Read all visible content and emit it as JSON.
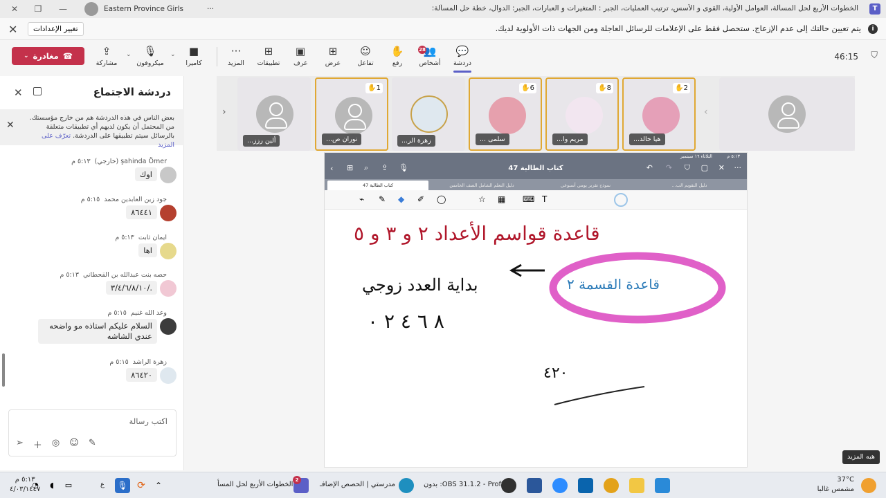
{
  "window": {
    "title": "الخطوات الأربع لحل المسألة، العوامل الأولية، القوى و الأسس، ترتيب العمليات، الجبر : المتغيرات و العبارات، الجبر: الدوال، خطة حل المسألة: التخمين والـ...",
    "account": "Eastern Province Girls",
    "more": "···",
    "app_icon_label": "T"
  },
  "notification": {
    "message": "يتم تعيين حالتك إلى عدم الإزعاج. ستحصل فقط على الإعلامات للرسائل العاجلة ومن الجهات ذات الأولوية لديك.",
    "change_settings": "تغيير الإعدادات",
    "info": "i"
  },
  "toolbar": {
    "timer": "46:15",
    "leave": "مغادرة",
    "share": "مشاركة",
    "mic": "ميكروفون",
    "camera": "كاميرا",
    "more": "المزيد",
    "apps": "تطبيقات",
    "rooms": "غرف",
    "view": "عرض",
    "react": "تفاعل",
    "raise": "رفع",
    "people": "أشخاص",
    "people_count": "28",
    "chat": "دردشة"
  },
  "chat": {
    "title": "دردشة الاجتماع",
    "warning": "بعض الناس في هذه الدردشة هم من خارج مؤسستك. من المحتمل أن يكون لديهم أي تطبيقات متعلقة بالرسائل سيتم تطبيقها على الدردشة.",
    "warning_link": "تعرّف على المزيد",
    "compose_placeholder": "اكتب رسالة",
    "messages": [
      {
        "sender": "şahinda Ömer (خارجي)",
        "time": "٥:١٣ م",
        "text": "اوك"
      },
      {
        "sender": "جود زين العابدين محمد",
        "time": "٥:١٥ م",
        "text": "٨٦٤٤١"
      },
      {
        "sender": "ايمان ثابت",
        "time": "٥:١٣ م",
        "text": "اها"
      },
      {
        "sender": "حصه بنت عبدالله بن القحطاني",
        "time": "٥:١٣ م",
        "text": "./٣/٤/٦/٨/١٠"
      },
      {
        "sender": "وعد الله غنيم",
        "time": "٥:١٥ م",
        "text": "السلام عليكم استاذه مو واضحه عندي الشاشه"
      },
      {
        "sender": "زهرة الراشد",
        "time": "٥:١٥ م",
        "text": "٨٦٤٢٠"
      }
    ]
  },
  "participants": [
    {
      "name": "هيا خالد...",
      "hand": "2",
      "raised": true,
      "avatar_color": "#e5a0b8"
    },
    {
      "name": "مريم وا...",
      "hand": "8",
      "raised": true,
      "avatar_color": "#f2e6f0"
    },
    {
      "name": "سلمى ...",
      "hand": "6",
      "raised": true,
      "avatar_color": "#e6a0ad"
    },
    {
      "name": "زهرة الر...",
      "hand": "",
      "raised": false,
      "avatar_color": "#dfe8ef"
    },
    {
      "name": "نوران ص...",
      "hand": "1",
      "raised": true,
      "avatar_color": "#b8b8b8"
    },
    {
      "name": "ألين رزز...",
      "hand": "",
      "raised": false,
      "avatar_color": "#b8b8b8"
    }
  ],
  "shared": {
    "status_time": "٥:١٣ م",
    "status_date": "الثلاثاء ١٦ سبتمبر",
    "doc_title": "كتاب الطالبة 47",
    "tabs": [
      "كتاب الطالبة 47",
      "دليل التعلم الشامل الصف الخامس",
      "نموذج تقرير يومي أسبوعي",
      "دليل التقويم الب..."
    ],
    "line1": "قاعدة قواسم الأعداد ٢ و ٣ و ٥",
    "bubble": "قاعدة القسمة ٢",
    "line2": "بداية العدد زوجي",
    "line3": "٨ ٦ ٤ ٢ ٠",
    "scribble": "٤٢٠"
  },
  "see_more": "هبه المزيد",
  "taskbar": {
    "weather_temp": "37°C",
    "weather_desc": "مشمس غالبا",
    "time": "٥:١٣ م",
    "date": "٤/٠٣/١٤٤٧",
    "lang": "ع",
    "obs": "OBS 31.1.2 - Profile: بدون",
    "edge": "مدرستي | الحصص الإضافـ",
    "teams": "الخطوات الأربع لحل المسأ",
    "teams_badge": "2"
  }
}
